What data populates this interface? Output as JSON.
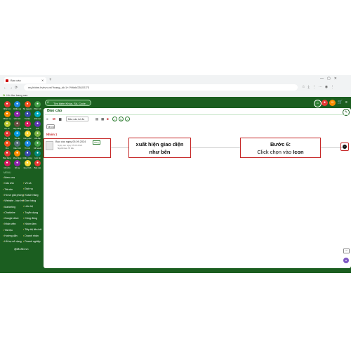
{
  "browser": {
    "tab_title": "Báo cáo",
    "url": "my.hbbm.hvkvn.vn/?trang_id=1+/?Hinh/25157/73",
    "bookmark": "Hồ thư trang sao"
  },
  "app": {
    "search_placeholder": "Tìm kiếm Khóa, Số, Code...",
    "page_title": "Báo cáo",
    "type_select": "Báo cáo lưi đa",
    "tab_all": "Tất cả",
    "group_label": "Nhóm 1",
    "brand": "@MoSD.vn",
    "report": {
      "name": "Báo cáo ngày 05.09.2024",
      "tag": "Hằng",
      "date": "Ngày tạo ngày 05.09.2024",
      "owner": "Người tạo: Vĩ Hà"
    }
  },
  "sidebar": {
    "apps": [
      {
        "label": "Nhân lực",
        "color": "#e53935"
      },
      {
        "label": "Khiếu nại",
        "color": "#1e88e5"
      },
      {
        "label": "Tài nguyên",
        "color": "#f4511e"
      },
      {
        "label": "Phân tích",
        "color": "#43a047"
      },
      {
        "label": "Nhiệm vụ",
        "color": "#fb8c00"
      },
      {
        "label": "Văn bản",
        "color": "#8e24aa"
      },
      {
        "label": "Tài liệu",
        "color": "#3949ab"
      },
      {
        "label": "Đào tạo",
        "color": "#00acc1"
      },
      {
        "label": "Dự án",
        "color": "#c0ca33"
      },
      {
        "label": "Hợp đồng",
        "color": "#6d4c41"
      },
      {
        "label": "Thống kê",
        "color": "#d81b60"
      },
      {
        "label": "Lịch",
        "color": "#5e35b1"
      },
      {
        "label": "Thu chi",
        "color": "#e53935"
      },
      {
        "label": "Tài sản",
        "color": "#039be5"
      },
      {
        "label": "Công việc",
        "color": "#fdd835"
      },
      {
        "label": "Hỏi đáp",
        "color": "#7cb342"
      },
      {
        "label": "Kho",
        "color": "#f4511e"
      },
      {
        "label": "Cấu hình",
        "color": "#546e7a"
      },
      {
        "label": "Tin tức",
        "color": "#1e88e5"
      },
      {
        "label": "Kế hoạch",
        "color": "#43a047"
      },
      {
        "label": "Bán hàng",
        "color": "#e53935"
      },
      {
        "label": "Mua hàng",
        "color": "#fb8c00"
      },
      {
        "label": "Chấm công",
        "color": "#3949ab"
      },
      {
        "label": "Liên hệ",
        "color": "#00897b"
      },
      {
        "label": "Ghi chú",
        "color": "#d81b60"
      },
      {
        "label": "Sổ tay",
        "color": "#8e24aa"
      },
      {
        "label": "Quy trình",
        "color": "#fdd835"
      },
      {
        "label": "Báo cáo",
        "color": "#e53935"
      }
    ],
    "section_label": "MENU",
    "menu_left": [
      "Menu mẹ",
      "Cấu chú",
      "Tài sản",
      "Hồ sơ giải phóng",
      "Website - bán hết",
      "Marketing",
      "Chatdrive",
      "Google drive",
      "Nhân viên",
      "Tài liệu",
      "Hướng dẫn",
      "Hỗ trợ sử dụng"
    ],
    "menu_right": [
      "Vỏ cá",
      "Địch vụ",
      "Khách hàng",
      "Đơn hàng",
      "Liên hệ",
      "Tuyển dụng",
      "Cộng đồng",
      "Nhóm làm",
      "Tiếp thị liên kết",
      "Doanh nhân",
      "Doanh nghiệp"
    ]
  },
  "annotations": {
    "callout1_line1": "xuất hiện giao diện",
    "callout1_line2": "như bên",
    "callout2_title": "Bước 6:",
    "callout2_prefix": "Click chọn vào ",
    "callout2_bold": "Icon"
  }
}
